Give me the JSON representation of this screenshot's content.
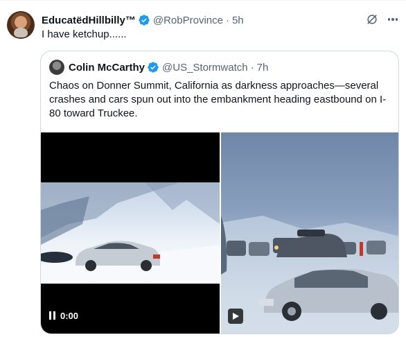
{
  "tweet": {
    "display_name": "EducatëdHillbilly™",
    "handle": "@RobProvince",
    "separator": "·",
    "time": "5h",
    "text": "I have ketchup......"
  },
  "quoted_tweet": {
    "display_name": "Colin McCarthy",
    "handle": "@US_Stormwatch",
    "separator": "·",
    "time": "7h",
    "text": "Chaos on Donner Summit, California as darkness approaches—several crashes and cars spun out into the embankment heading eastbound on I-80 toward Truckee.",
    "media": {
      "video_time": "0:00"
    }
  },
  "colors": {
    "verified_blue": "#1d9bf0",
    "secondary_text": "#536471",
    "border": "#cfd9de"
  },
  "icons": {
    "verified": "verified-badge-icon",
    "grok": "grok-icon",
    "more": "more-icon",
    "pause": "pause-icon",
    "play": "play-icon"
  }
}
